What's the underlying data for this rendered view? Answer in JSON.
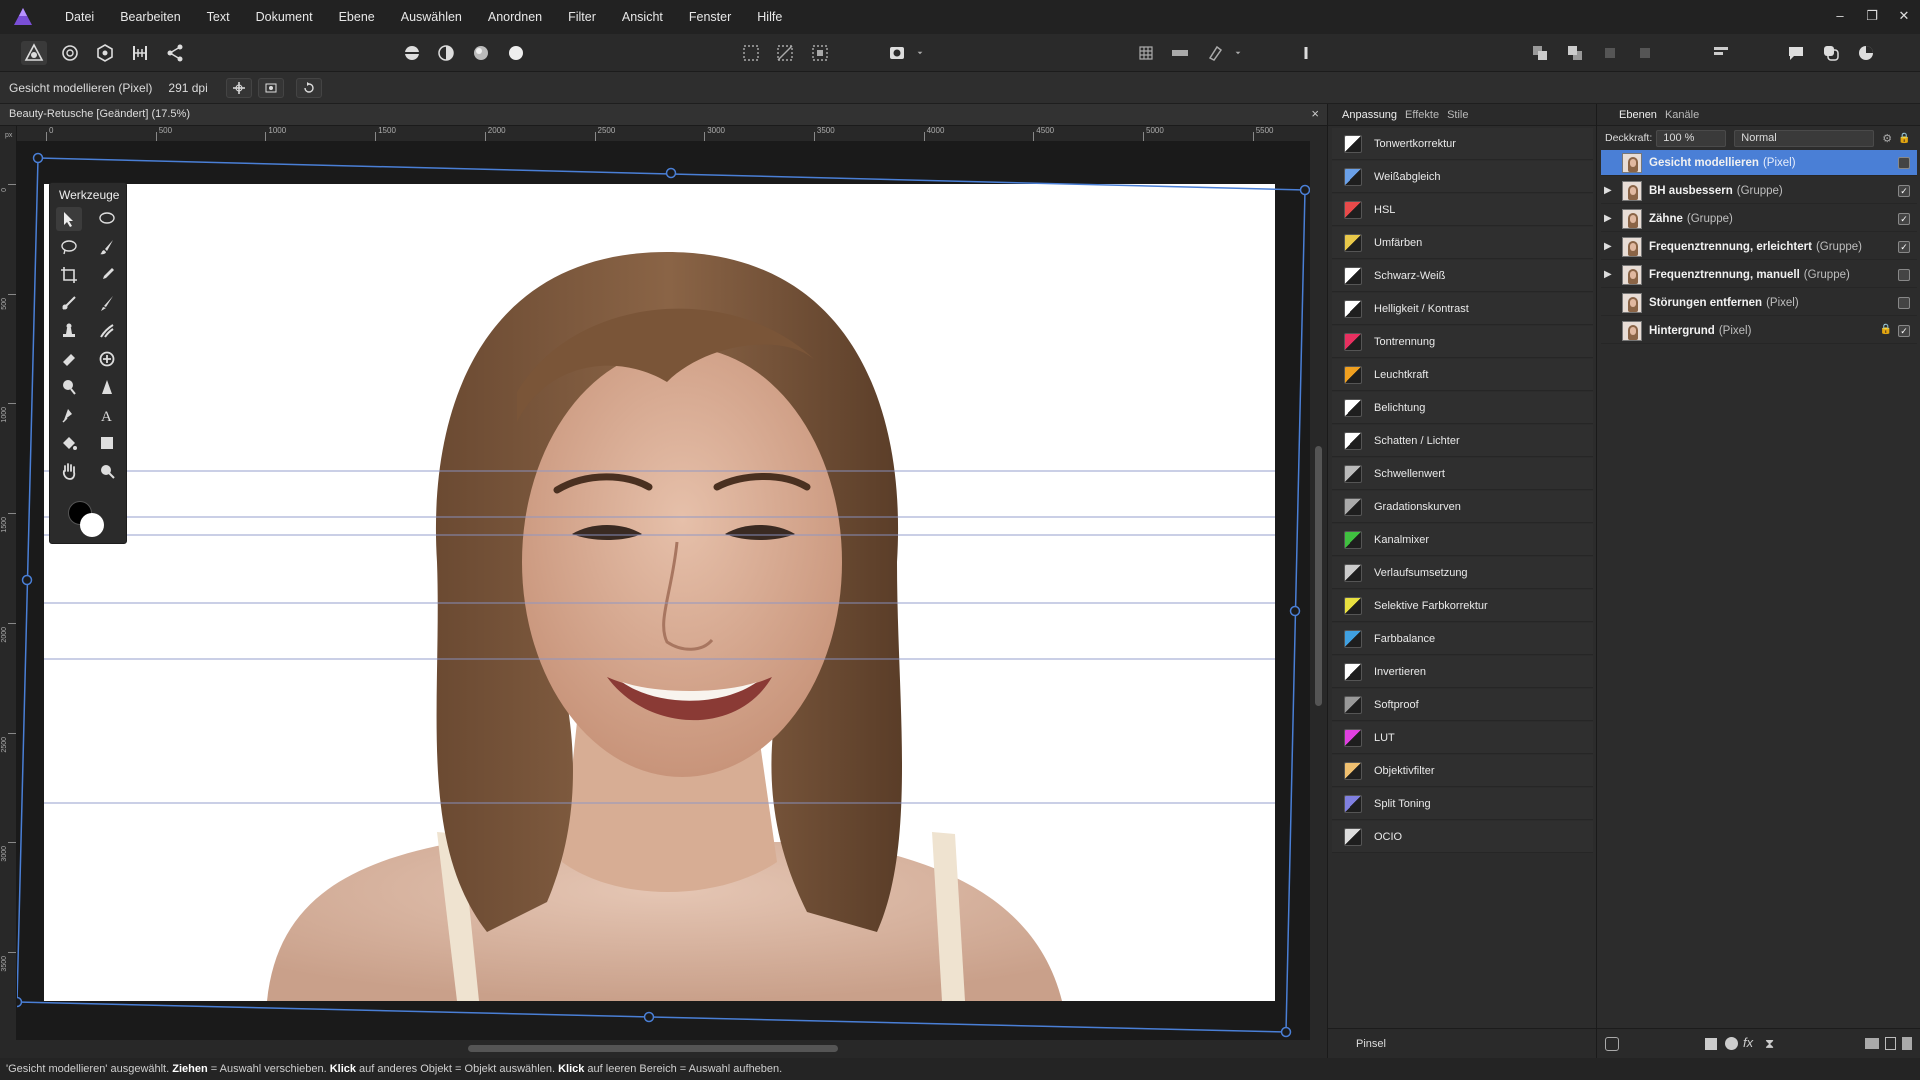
{
  "app": {
    "accent": "#4a7fd6",
    "logo_icon": "affinity-photo-icon"
  },
  "menu": [
    "Datei",
    "Bearbeiten",
    "Text",
    "Dokument",
    "Ebene",
    "Auswählen",
    "Anordnen",
    "Filter",
    "Ansicht",
    "Fenster",
    "Hilfe"
  ],
  "window_controls": {
    "minimize": "–",
    "restore": "❐",
    "close": "✕"
  },
  "context": {
    "tool_name": "Gesicht modellieren (Pixel)",
    "dpi": "291 dpi"
  },
  "document": {
    "tab_title": "Beauty-Retusche [Geändert] (17.5%)",
    "close": "×"
  },
  "ruler": {
    "unit": "px",
    "top_ticks": [
      "0",
      "500",
      "1000",
      "1500",
      "2000",
      "2500",
      "3000",
      "3500",
      "4000",
      "4500",
      "5000",
      "5500"
    ],
    "left_ticks": [
      "0",
      "500",
      "1000",
      "1500",
      "2000",
      "2500",
      "3000",
      "3500"
    ]
  },
  "tools_panel": {
    "title": "Werkzeuge"
  },
  "adjustment_panel": {
    "tabs": [
      "Anpassung",
      "Effekte",
      "Stile"
    ],
    "items": [
      {
        "label": "Tonwertkorrektur",
        "icon": "levels-icon",
        "color": "#ffffff"
      },
      {
        "label": "Weißabgleich",
        "icon": "white-balance-icon",
        "color": "#6aa0e8"
      },
      {
        "label": "HSL",
        "icon": "hsl-icon",
        "color": "#e84a4a"
      },
      {
        "label": "Umfärben",
        "icon": "recolor-icon",
        "color": "#e8c84a"
      },
      {
        "label": "Schwarz-Weiß",
        "icon": "black-white-icon",
        "color": "#ffffff"
      },
      {
        "label": "Helligkeit / Kontrast",
        "icon": "brightness-contrast-icon",
        "color": "#ffffff"
      },
      {
        "label": "Tontrennung",
        "icon": "posterize-icon",
        "color": "#e83060"
      },
      {
        "label": "Leuchtkraft",
        "icon": "vibrance-icon",
        "color": "#f0a020"
      },
      {
        "label": "Belichtung",
        "icon": "exposure-icon",
        "color": "#ffffff"
      },
      {
        "label": "Schatten / Lichter",
        "icon": "shadows-highlights-icon",
        "color": "#ffffff"
      },
      {
        "label": "Schwellenwert",
        "icon": "threshold-icon",
        "color": "#bbbbbb"
      },
      {
        "label": "Gradationskurven",
        "icon": "curves-icon",
        "color": "#aaaaaa"
      },
      {
        "label": "Kanalmixer",
        "icon": "channel-mixer-icon",
        "color": "#40c040"
      },
      {
        "label": "Verlaufsumsetzung",
        "icon": "gradient-map-icon",
        "color": "#cccccc"
      },
      {
        "label": "Selektive Farbkorrektur",
        "icon": "selective-color-icon",
        "color": "#e8e040"
      },
      {
        "label": "Farbbalance",
        "icon": "color-balance-icon",
        "color": "#40a0e0"
      },
      {
        "label": "Invertieren",
        "icon": "invert-icon",
        "color": "#ffffff"
      },
      {
        "label": "Softproof",
        "icon": "soft-proof-icon",
        "color": "#999999"
      },
      {
        "label": "LUT",
        "icon": "lut-icon",
        "color": "#e040e0"
      },
      {
        "label": "Objektivfilter",
        "icon": "lens-filter-icon",
        "color": "#f0c070"
      },
      {
        "label": "Split Toning",
        "icon": "split-toning-icon",
        "color": "#8080e0"
      },
      {
        "label": "OCIO",
        "icon": "ocio-icon",
        "color": "#dddddd"
      }
    ],
    "bottom_tab": "Pinsel"
  },
  "layers_panel": {
    "tabs": [
      "Ebenen",
      "Kanäle"
    ],
    "opacity_label": "Deckkraft:",
    "opacity_value": "100 %",
    "blend_mode": "Normal",
    "layers": [
      {
        "name": "Gesicht modellieren",
        "type": "(Pixel)",
        "selected": true,
        "expand": "",
        "checked": false,
        "locked": false
      },
      {
        "name": "BH ausbessern",
        "type": "(Gruppe)",
        "selected": false,
        "expand": "▶",
        "checked": true,
        "locked": false
      },
      {
        "name": "Zähne",
        "type": "(Gruppe)",
        "selected": false,
        "expand": "▶",
        "checked": true,
        "locked": false
      },
      {
        "name": "Frequenztrennung, erleichtert",
        "type": "(Gruppe)",
        "selected": false,
        "expand": "▶",
        "checked": true,
        "locked": false
      },
      {
        "name": "Frequenztrennung, manuell",
        "type": "(Gruppe)",
        "selected": false,
        "expand": "▶",
        "checked": false,
        "locked": false
      },
      {
        "name": "Störungen entfernen",
        "type": "(Pixel)",
        "selected": false,
        "expand": "",
        "checked": false,
        "locked": false
      },
      {
        "name": "Hintergrund",
        "type": "(Pixel)",
        "selected": false,
        "expand": "",
        "checked": true,
        "locked": true
      }
    ]
  },
  "status": {
    "p1": "'Gesicht modellieren' ausgewählt. ",
    "b1": "Ziehen",
    "p2": " = Auswahl verschieben. ",
    "b2": "Klick",
    "p3": " auf anderes Objekt = Objekt auswählen. ",
    "b3": "Klick",
    "p4": " auf leeren Bereich = Auswahl aufheben."
  }
}
